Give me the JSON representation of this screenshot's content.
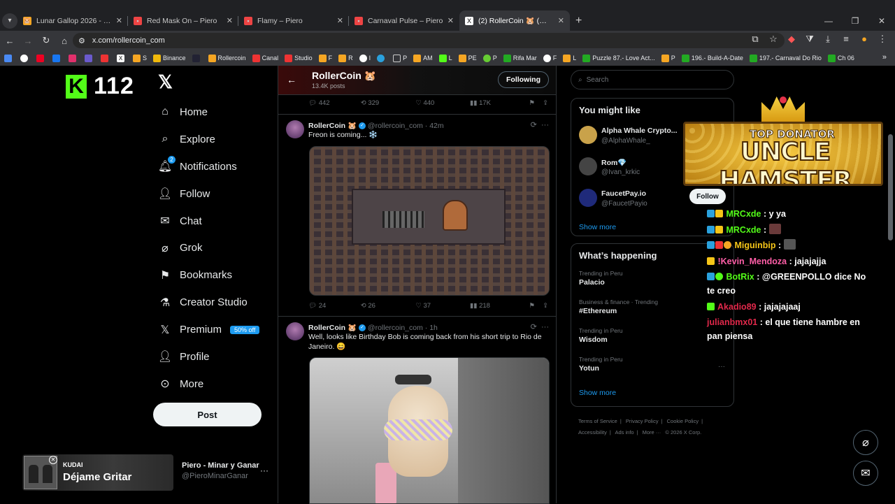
{
  "browser": {
    "tabs": [
      {
        "title": "Lunar Gallop 2026 - RollerCoin",
        "active": false
      },
      {
        "title": "Red Mask On – Piero",
        "active": false
      },
      {
        "title": "Flamy – Piero",
        "active": false
      },
      {
        "title": "Carnaval Pulse – Piero",
        "active": false
      },
      {
        "title": "(2) RollerCoin 🐹 (@rollercoin_",
        "active": true
      }
    ],
    "url": "x.com/rollercoin_com",
    "bookmarks": [
      "",
      "",
      "",
      "",
      "",
      "",
      "",
      "",
      "S",
      "Binance",
      "",
      "Rollercoin",
      "Canal",
      "Studio",
      "F",
      "R",
      "I",
      "",
      "P",
      "AM",
      "L",
      "PE",
      "P",
      "Rifa Mar",
      "F",
      "L",
      "Puzzle 87.- Love Act...",
      "P",
      "196.- Build-A-Date",
      "197.- Carnaval Do Rio",
      "Ch 06"
    ]
  },
  "kick": {
    "logo": "K",
    "count": "112"
  },
  "sidebar": {
    "items": [
      {
        "label": "Home",
        "icon": "home-icon"
      },
      {
        "label": "Explore",
        "icon": "search-icon"
      },
      {
        "label": "Notifications",
        "icon": "bell-icon",
        "badge": "2"
      },
      {
        "label": "Follow",
        "icon": "follow-icon"
      },
      {
        "label": "Chat",
        "icon": "mail-icon"
      },
      {
        "label": "Grok",
        "icon": "grok-icon"
      },
      {
        "label": "Bookmarks",
        "icon": "bookmark-icon"
      },
      {
        "label": "Creator Studio",
        "icon": "flask-icon"
      },
      {
        "label": "Premium",
        "icon": "x-icon",
        "badge_text": "50% off"
      },
      {
        "label": "Profile",
        "icon": "person-icon"
      },
      {
        "label": "More",
        "icon": "more-circle-icon"
      }
    ],
    "post_label": "Post",
    "account_name": "Piero - Minar y Ganar",
    "account_handle": "@PieroMinarGanar"
  },
  "now_playing": {
    "band": "KUDAI",
    "song": "Déjame Gritar"
  },
  "profile_header": {
    "name": "RollerCoin 🐹",
    "posts": "13.4K posts",
    "following_label": "Following"
  },
  "prev_post_actions": {
    "replies": "442",
    "reposts": "329",
    "likes": "440",
    "views": "17K"
  },
  "tweets": [
    {
      "name": "RollerCoin 🐹",
      "handle": "@rollercoin_com",
      "time": "42m",
      "text": "Freon is coming... ❄️",
      "actions": {
        "replies": "24",
        "reposts": "26",
        "likes": "37",
        "views": "218"
      }
    },
    {
      "name": "RollerCoin 🐹",
      "handle": "@rollercoin_com",
      "time": "1h",
      "text": "Well, looks like Birthday Bob is coming back from his short trip to Rio de Janeiro. 😄"
    }
  ],
  "search_placeholder": "Search",
  "might_like": {
    "title": "You might like",
    "accounts": [
      {
        "name": "Alpha Whale Crypto...",
        "handle": "@AlphaWhale_"
      },
      {
        "name": "Rom💎",
        "handle": "@Ivan_krkic"
      },
      {
        "name": "FaucetPay.io",
        "handle": "@FaucetPayio"
      }
    ],
    "show_more": "Show more"
  },
  "happening": {
    "title": "What’s happening",
    "trends": [
      {
        "context": "Trending in Peru",
        "topic": "Palacio"
      },
      {
        "context": "Business & finance · Trending",
        "topic": "#Ethereum"
      },
      {
        "context": "Trending in Peru",
        "topic": "Wisdom"
      },
      {
        "context": "Trending in Peru",
        "topic": "Yotun"
      }
    ],
    "show_more": "Show more"
  },
  "footer_links": [
    "Terms of Service",
    "|",
    "Privacy Policy",
    "|",
    "Cookie Policy",
    "|",
    "Accessibility",
    "|",
    "Ads info",
    "|",
    "More ···",
    "© 2026 X Corp."
  ],
  "overlay": {
    "donor_tag": "TOP DONATOR",
    "donor_name": "UNCLE HAMSTER",
    "follow_label": "Follow",
    "chat": [
      {
        "user": "MRCxde",
        "color": "#53fc18",
        "text": ": y ya"
      },
      {
        "user": "MRCxde",
        "color": "#53fc18",
        "text": ":"
      },
      {
        "user": "Miguinbip",
        "color": "#f5c518",
        "text": ":"
      },
      {
        "user": "!Kevin_Mendoza",
        "color": "#ff5fa8",
        "text": ": jajajajja"
      },
      {
        "user": "BotRix",
        "color": "#53fc18",
        "text": ": @GREENPOLLO dice No te creo"
      },
      {
        "user": "Akadio89",
        "color": "#e0284a",
        "text": ": jajajajaaj"
      },
      {
        "user": "julianbmx01",
        "color": "#e0284a",
        "text": ": el que tiene hambre en pan piensa"
      }
    ]
  }
}
